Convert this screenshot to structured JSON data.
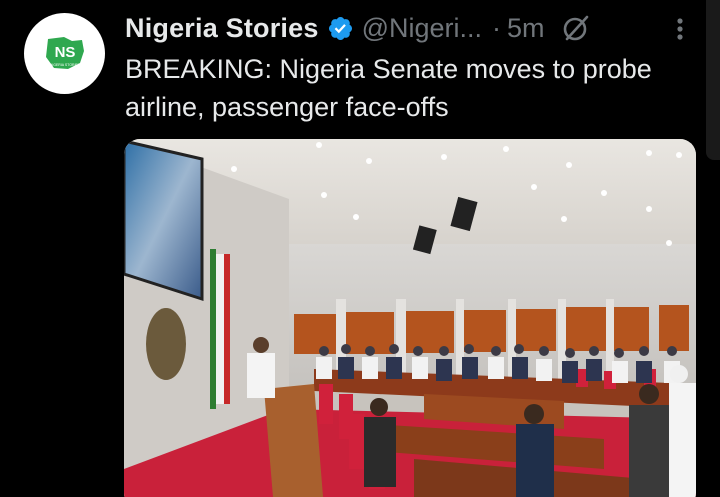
{
  "tweet": {
    "display_name": "Nigeria Stories",
    "handle": "@Nigeri...",
    "separator": "·",
    "time": "5m",
    "text": "BREAKING: Nigeria Senate moves to probe airline, passenger face-offs",
    "avatar_logo_text": "NS",
    "avatar_logo_subtext": "NIGERIA STORIES",
    "verified_icon": "verified-badge-icon",
    "colors": {
      "background": "#000000",
      "primary_text": "#e7e9ea",
      "secondary_text": "#71767b",
      "verified_blue": "#1d9bf0",
      "logo_green": "#2fa84f"
    }
  },
  "media": {
    "description_icon": "senate-chamber-photo"
  }
}
